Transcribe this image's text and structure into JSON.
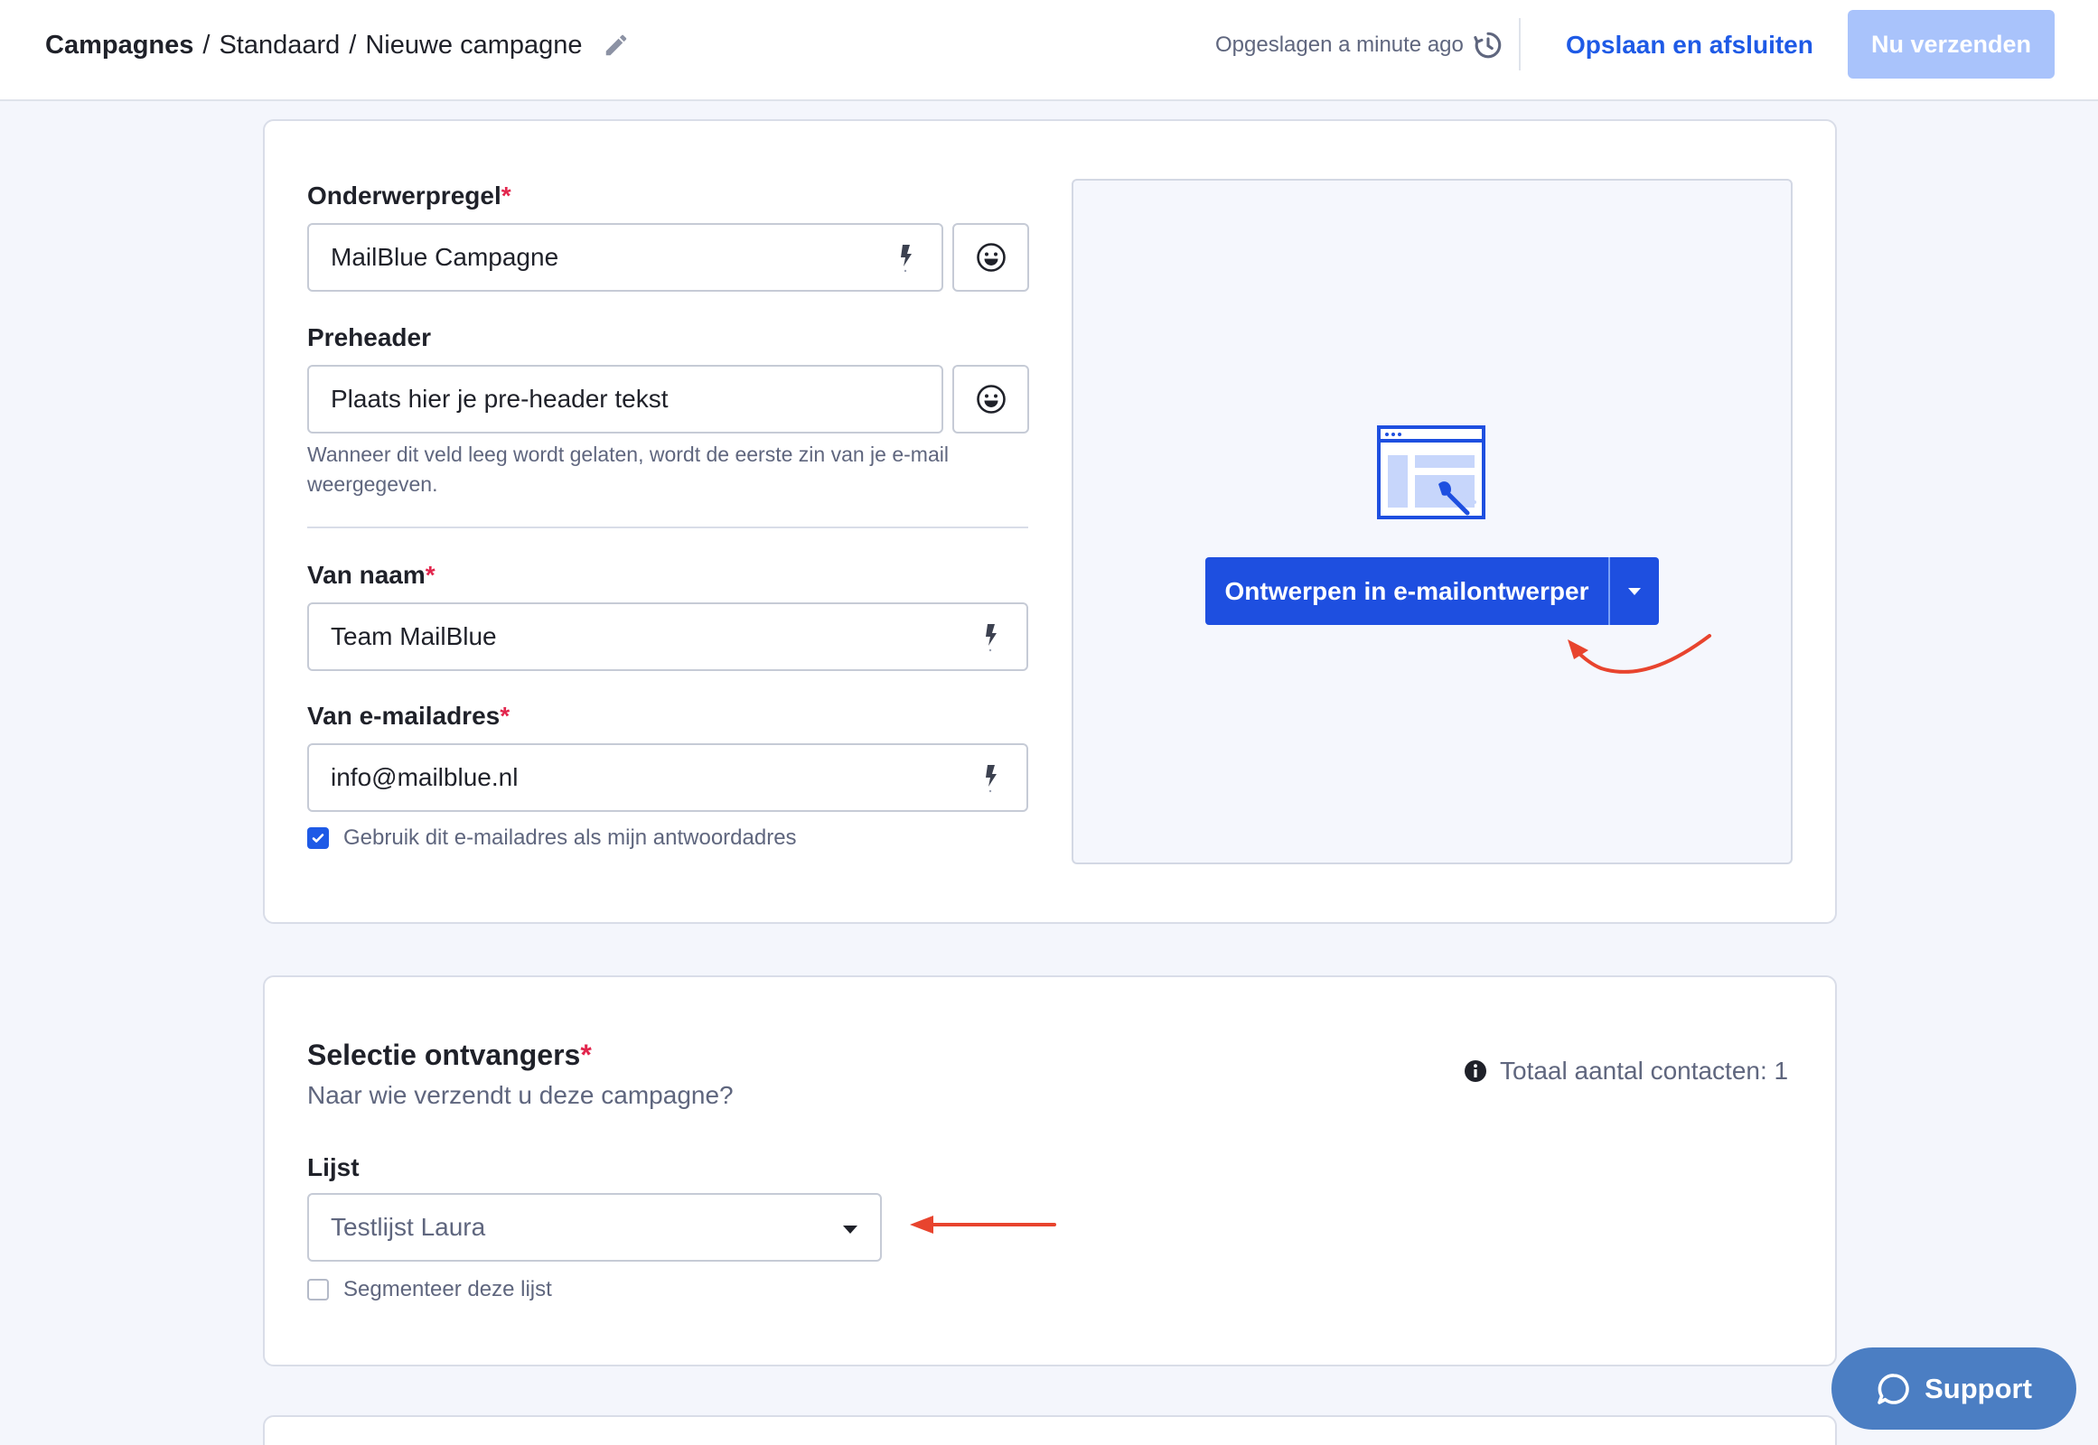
{
  "header": {
    "breadcrumb": {
      "root": "Campagnes",
      "sep1": "/",
      "middle": "Standaard",
      "sep2": "/",
      "current": "Nieuwe campagne"
    },
    "saved_status": "Opgeslagen a minute ago",
    "save_close_label": "Opslaan en afsluiten",
    "send_now_label": "Nu verzenden"
  },
  "message": {
    "subject_label": "Onderwerpregel",
    "subject_value": "MailBlue Campagne",
    "preheader_label": "Preheader",
    "preheader_value": "Plaats hier je pre-header tekst",
    "preheader_help": "Wanneer dit veld leeg wordt gelaten, wordt de eerste zin van je e-mail weergegeven.",
    "from_name_label": "Van naam",
    "from_name_value": "Team MailBlue",
    "from_email_label": "Van e-mailadres",
    "from_email_value": "info@mailblue.nl",
    "reply_checkbox_label": "Gebruik dit e-mailadres als mijn antwoordadres",
    "reply_checkbox_checked": true,
    "required_mark": "*"
  },
  "designer": {
    "design_button_label": "Ontwerpen in e-mailontwerper"
  },
  "recipients": {
    "title": "Selectie ontvangers",
    "subtitle": "Naar wie verzendt u deze campagne?",
    "total_contacts": "Totaal aantal contacten: 1",
    "list_label": "Lijst",
    "list_value": "Testlijst Laura",
    "segment_checkbox_label": "Segmenteer deze lijst",
    "segment_checkbox_checked": false
  },
  "support": {
    "label": "Support"
  },
  "colors": {
    "accent": "#1e4fe0",
    "link": "#1e5ae6",
    "disabled_button": "#a9c3fb",
    "required": "#e2264d",
    "annotation": "#e8442e",
    "support_button": "#4b7ec3"
  }
}
